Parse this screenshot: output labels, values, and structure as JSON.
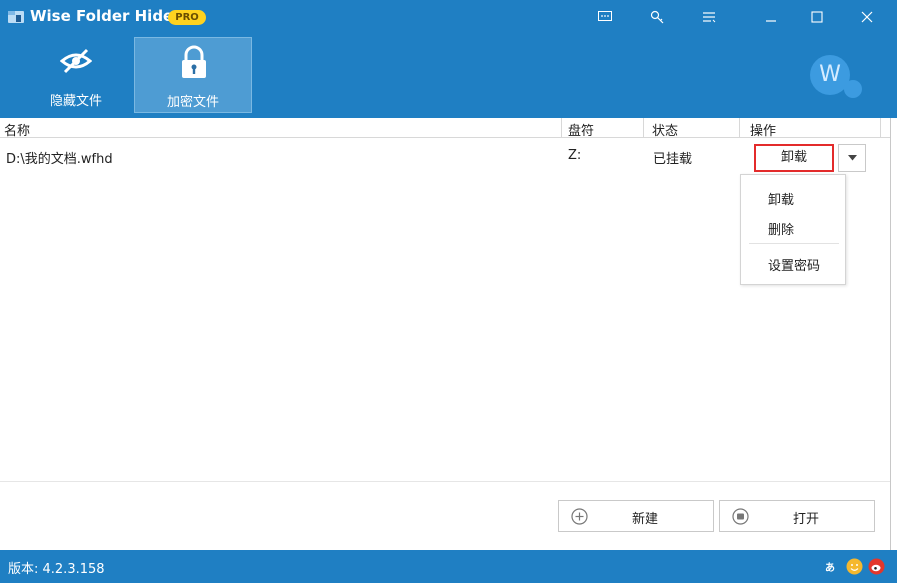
{
  "titlebar": {
    "title": "Wise Folder Hider",
    "badge": "PRO",
    "icons": [
      "feedback-icon",
      "key-icon",
      "menu-icon",
      "minimize-icon",
      "maximize-icon",
      "close-icon"
    ]
  },
  "nav": {
    "tabs": [
      {
        "label": "隐藏文件",
        "icon": "hidden-eye-icon",
        "active": false
      },
      {
        "label": "加密文件",
        "icon": "lock-icon",
        "active": true
      }
    ]
  },
  "account": {
    "initial": "W"
  },
  "table": {
    "headers": [
      "名称",
      "盘符",
      "状态",
      "操作"
    ],
    "rows": [
      {
        "name": "D:\\我的文档.wfhd",
        "drive": "Z:",
        "status": "已挂载",
        "action": "卸载"
      }
    ]
  },
  "dropdown": {
    "items": [
      "卸载",
      "删除",
      "设置密码"
    ]
  },
  "footer": {
    "new_label": "新建",
    "open_label": "打开"
  },
  "statusbar": {
    "version": "版本: 4.2.3.158",
    "icons": [
      "language-icon",
      "smile-icon",
      "weibo-icon"
    ]
  },
  "colors": {
    "brand": "#1f7fc3",
    "active_tab": "#4e9cd3",
    "highlight_border": "#e32b2b",
    "badge": "#ffd21f"
  }
}
